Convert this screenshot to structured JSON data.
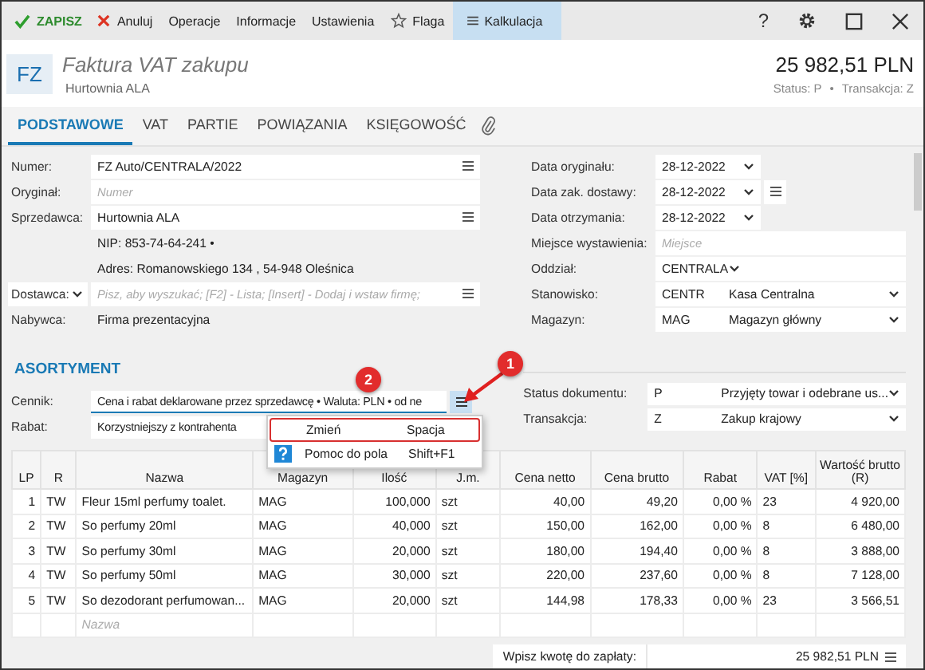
{
  "toolbar": {
    "items": [
      {
        "label": "ZAPISZ",
        "selected": false
      },
      {
        "label": "Anuluj",
        "selected": false
      },
      {
        "label": "Operacje",
        "selected": false
      },
      {
        "label": "Informacje",
        "selected": false
      },
      {
        "label": "Ustawienia",
        "selected": false
      },
      {
        "label": "Flaga",
        "selected": false
      },
      {
        "label": "Kalkulacja",
        "selected": true
      }
    ],
    "help": "?"
  },
  "header": {
    "badge": "FZ",
    "title": "Faktura VAT zakupu",
    "subtitle": "Hurtownia ALA",
    "amount": "25 982,51 PLN",
    "status": "Status:  P",
    "separator": "•",
    "transaction": "Transakcja:  Z"
  },
  "tabs": [
    {
      "label": "PODSTAWOWE",
      "selected": true
    },
    {
      "label": "VAT",
      "selected": false
    },
    {
      "label": "PARTIE",
      "selected": false
    },
    {
      "label": "POWIĄZANIA",
      "selected": false
    },
    {
      "label": "KSIĘGOWOŚĆ",
      "selected": false
    }
  ],
  "left_form": [
    {
      "kind": "field",
      "label": "Numer:",
      "value": "FZ Auto/CENTRALA/2022",
      "menu": true
    },
    {
      "kind": "field",
      "label": "Oryginał:",
      "placeholder": "Numer",
      "menu": false
    },
    {
      "kind": "field",
      "label": "Sprzedawca:",
      "value": "Hurtownia ALA",
      "menu": true
    },
    {
      "kind": "info",
      "value": "NIP:  853-74-64-241  •"
    },
    {
      "kind": "info",
      "value": "Adres:  Romanowskiego 134 , 54-948 Oleśnica"
    },
    {
      "kind": "select_label",
      "label": "Dostawca:",
      "placeholder": "Pisz, aby wyszukać; [F2] - Lista; [Insert] - Dodaj i wstaw firmę;",
      "menu": true
    },
    {
      "kind": "info",
      "label": "Nabywca:",
      "value": "Firma prezentacyjna"
    }
  ],
  "right_form": [
    {
      "kind": "date",
      "label": "Data oryginału:",
      "value": "28-12-2022",
      "menu": false
    },
    {
      "kind": "date",
      "label": "Data zak. dostawy:",
      "value": "28-12-2022",
      "menu": true
    },
    {
      "kind": "date",
      "label": "Data otrzymania:",
      "value": "28-12-2022",
      "menu": false
    },
    {
      "kind": "field",
      "label": "Miejsce wystawienia:",
      "placeholder": "Miejsce"
    },
    {
      "kind": "select",
      "label": "Oddział:",
      "code": "CENTRALA"
    },
    {
      "kind": "select",
      "label": "Stanowisko:",
      "code": "CENTR",
      "name": "Kasa Centralna"
    },
    {
      "kind": "select",
      "label": "Magazyn:",
      "code": "MAG",
      "name": "Magazyn główny"
    }
  ],
  "section": {
    "title": "ASORTYMENT",
    "left": [
      {
        "label": "Cennik:",
        "value": "Cena i rabat deklarowane przez sprzedawcę • Waluta: PLN • od ne",
        "menu": true
      },
      {
        "label": "Rabat:",
        "value": "Korzystniejszy z kontrahenta",
        "menu": false
      }
    ],
    "right": [
      {
        "label": "Status dokumentu:",
        "code": "P",
        "name": "Przyjęty towar i odebrane us..."
      },
      {
        "label": "Transakcja:",
        "code": "Z",
        "name": "Zakup krajowy"
      }
    ]
  },
  "table": {
    "columns": [
      "LP",
      "R",
      "Nazwa",
      "Magazyn",
      "Ilość",
      "J.m.",
      "Cena netto",
      "Cena brutto",
      "Rabat",
      "VAT [%]",
      "Wartość brutto (R)"
    ],
    "rows": [
      [
        "1",
        "TW",
        "Fleur 15ml perfumy toalet.",
        "MAG",
        "100,000",
        "szt",
        "40,00",
        "49,20",
        "0,00 %",
        "23",
        "4 920,00"
      ],
      [
        "2",
        "TW",
        "So perfumy 20ml",
        "MAG",
        "40,000",
        "szt",
        "150,00",
        "162,00",
        "0,00 %",
        "8",
        "6 480,00"
      ],
      [
        "3",
        "TW",
        "So perfumy 30ml",
        "MAG",
        "20,000",
        "szt",
        "180,00",
        "194,40",
        "0,00 %",
        "8",
        "3 888,00"
      ],
      [
        "4",
        "TW",
        "So perfumy 50ml",
        "MAG",
        "30,000",
        "szt",
        "220,00",
        "237,60",
        "0,00 %",
        "8",
        "7 128,00"
      ],
      [
        "5",
        "TW",
        "So dezodorant perfumowan...",
        "MAG",
        "20,000",
        "szt",
        "144,98",
        "178,33",
        "0,00 %",
        "23",
        "3 566,51"
      ]
    ],
    "new_row_placeholder": "Nazwa"
  },
  "footer": {
    "label": "Wpisz kwotę do zapłaty:",
    "value": "25 982,51 PLN"
  },
  "context_menu": [
    {
      "label": "Zmień",
      "shortcut": "Spacja",
      "selected": true
    },
    {
      "label": "Pomoc do pola",
      "shortcut": "Shift+F1",
      "selected": false
    }
  ],
  "annotations": [
    {
      "number": "1"
    },
    {
      "number": "2"
    }
  ]
}
